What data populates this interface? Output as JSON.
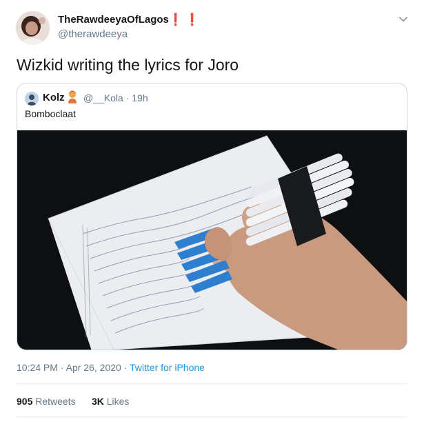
{
  "author": {
    "display_name": "TheRawdeeyaOfLagos",
    "name_decoration": "❗❗",
    "handle": "@therawdeeya",
    "avatar_icon": "profile-photo"
  },
  "tweet": {
    "text": "Wizkid writing the lyrics for Joro"
  },
  "quoted_tweet": {
    "display_name": "Kolz",
    "handle": "@__Kola",
    "separator": "·",
    "age": "19h",
    "text": "Bomboclaat"
  },
  "footer": {
    "time": "10:24 PM",
    "separator": "·",
    "date": "Apr 26, 2020",
    "source": "Twitter for iPhone"
  },
  "stats": {
    "retweets_count": "905",
    "retweets_label": "Retweets",
    "likes_count": "3K",
    "likes_label": "Likes"
  },
  "colors": {
    "link": "#1b95e0",
    "secondary_text": "#657786",
    "primary_text": "#14171a",
    "divider": "#e6ecf0",
    "decoration": "#e0245e"
  },
  "icons": {
    "menu": "chevron-down-icon"
  }
}
